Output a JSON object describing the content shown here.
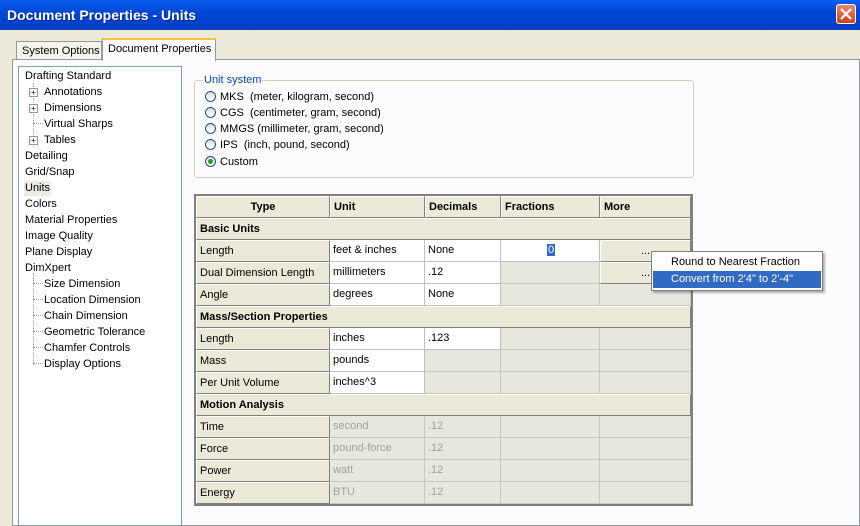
{
  "window": {
    "title": "Document Properties - Units"
  },
  "tabs": [
    {
      "label": "System Options"
    },
    {
      "label": "Document Properties"
    }
  ],
  "tree": {
    "items": [
      {
        "label": "Drafting Standard"
      },
      {
        "label": "Annotations"
      },
      {
        "label": "Dimensions"
      },
      {
        "label": "Virtual Sharps"
      },
      {
        "label": "Tables"
      },
      {
        "label": "Detailing"
      },
      {
        "label": "Grid/Snap"
      },
      {
        "label": "Units"
      },
      {
        "label": "Colors"
      },
      {
        "label": "Material Properties"
      },
      {
        "label": "Image Quality"
      },
      {
        "label": "Plane Display"
      },
      {
        "label": "DimXpert"
      },
      {
        "label": "Size Dimension"
      },
      {
        "label": "Location Dimension"
      },
      {
        "label": "Chain Dimension"
      },
      {
        "label": "Geometric Tolerance"
      },
      {
        "label": "Chamfer Controls"
      },
      {
        "label": "Display Options"
      }
    ],
    "selected": "Units"
  },
  "unit_system": {
    "legend": "Unit system",
    "options": [
      {
        "label": "MKS  (meter, kilogram, second)",
        "checked": false
      },
      {
        "label": "CGS  (centimeter, gram, second)",
        "checked": false
      },
      {
        "label": "MMGS (millimeter, gram, second)",
        "checked": false
      },
      {
        "label": "IPS  (inch, pound, second)",
        "checked": false
      },
      {
        "label": "Custom",
        "checked": true
      }
    ]
  },
  "grid": {
    "headers": [
      "Type",
      "Unit",
      "Decimals",
      "Fractions",
      "More"
    ],
    "sections": [
      {
        "title": "Basic Units",
        "rows": [
          {
            "type": "Length",
            "unit": "feet & inches",
            "decimals": "None",
            "fractions": "0",
            "more": "..."
          },
          {
            "type": "Dual Dimension Length",
            "unit": "millimeters",
            "decimals": ".12",
            "fractions": "",
            "more": "..."
          },
          {
            "type": "Angle",
            "unit": "degrees",
            "decimals": "None",
            "fractions": "",
            "more": ""
          }
        ]
      },
      {
        "title": "Mass/Section Properties",
        "rows": [
          {
            "type": "Length",
            "unit": "inches",
            "decimals": ".123",
            "fractions": "",
            "more": ""
          },
          {
            "type": "Mass",
            "unit": "pounds",
            "decimals": "",
            "fractions": "",
            "more": ""
          },
          {
            "type": "Per Unit Volume",
            "unit": "inches^3",
            "decimals": "",
            "fractions": "",
            "more": ""
          }
        ]
      },
      {
        "title": "Motion Analysis",
        "rows": [
          {
            "type": "Time",
            "unit": "second",
            "decimals": ".12",
            "fractions": "",
            "more": ""
          },
          {
            "type": "Force",
            "unit": "pound-force",
            "decimals": ".12",
            "fractions": "",
            "more": ""
          },
          {
            "type": "Power",
            "unit": "watt",
            "decimals": ".12",
            "fractions": "",
            "more": ""
          },
          {
            "type": "Energy",
            "unit": "BTU",
            "decimals": ".12",
            "fractions": "",
            "more": ""
          }
        ]
      }
    ]
  },
  "context_menu": {
    "items": [
      {
        "label": "Round to Nearest Fraction",
        "highlighted": false
      },
      {
        "label": "Convert from 2'4\" to 2'-4\"",
        "highlighted": true
      }
    ]
  },
  "colors": {
    "titlebar": "#0046d5",
    "highlight": "#316ac5",
    "legend": "#0046d5"
  }
}
